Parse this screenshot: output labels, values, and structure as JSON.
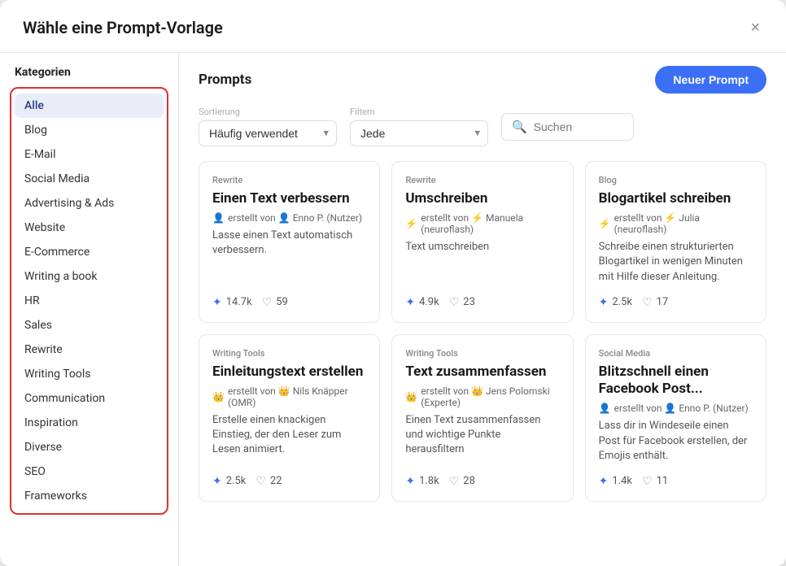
{
  "modal": {
    "title": "Wähle eine Prompt-Vorlage",
    "close_label": "×"
  },
  "sidebar": {
    "title": "Kategorien",
    "categories": [
      {
        "label": "Alle",
        "active": true
      },
      {
        "label": "Blog",
        "active": false
      },
      {
        "label": "E-Mail",
        "active": false
      },
      {
        "label": "Social Media",
        "active": false
      },
      {
        "label": "Advertising & Ads",
        "active": false
      },
      {
        "label": "Website",
        "active": false
      },
      {
        "label": "E-Commerce",
        "active": false
      },
      {
        "label": "Writing a book",
        "active": false
      },
      {
        "label": "HR",
        "active": false
      },
      {
        "label": "Sales",
        "active": false
      },
      {
        "label": "Rewrite",
        "active": false
      },
      {
        "label": "Writing Tools",
        "active": false
      },
      {
        "label": "Communication",
        "active": false
      },
      {
        "label": "Inspiration",
        "active": false
      },
      {
        "label": "Diverse",
        "active": false
      },
      {
        "label": "SEO",
        "active": false
      },
      {
        "label": "Frameworks",
        "active": false
      }
    ]
  },
  "prompts": {
    "title": "Prompts",
    "new_prompt_label": "Neuer Prompt",
    "sort_label": "Sortierung",
    "sort_value": "Häufig verwendet",
    "filter_label": "Filtern",
    "filter_value": "Jede",
    "search_placeholder": "Suchen"
  },
  "cards": [
    {
      "category": "Rewrite",
      "title": "Einen Text verbessern",
      "author": "Enno P. (Nutzer)",
      "author_icon": "user",
      "description": "Lasse einen Text automatisch verbessern.",
      "uses": "14.7k",
      "likes": "59"
    },
    {
      "category": "Rewrite",
      "title": "Umschreiben",
      "author": "Manuela (neuroflash)",
      "author_icon": "bolt",
      "description": "Text umschreiben",
      "uses": "4.9k",
      "likes": "23"
    },
    {
      "category": "Blog",
      "title": "Blogartikel schreiben",
      "author": "Julia (neuroflash)",
      "author_icon": "bolt",
      "description": "Schreibe einen strukturierten Blogartikel in wenigen Minuten mit Hilfe dieser Anleitung.",
      "uses": "2.5k",
      "likes": "17"
    },
    {
      "category": "Writing Tools",
      "title": "Einleitungstext erstellen",
      "author": "Nils Knäpper (OMR)",
      "author_icon": "crown",
      "description": "Erstelle einen knackigen Einstieg, der den Leser zum Lesen animiert.",
      "uses": "2.5k",
      "likes": "22"
    },
    {
      "category": "Writing Tools",
      "title": "Text zusammenfassen",
      "author": "Jens Polomski (Experte)",
      "author_icon": "crown",
      "description": "Einen Text zusammenfassen und wichtige Punkte herausfiltern",
      "uses": "1.8k",
      "likes": "28"
    },
    {
      "category": "Social Media",
      "title": "Blitzschnell einen Facebook Post...",
      "author": "Enno P. (Nutzer)",
      "author_icon": "user",
      "description": "Lass dir in Windeseile einen Post für Facebook erstellen, der Emojis enthält.",
      "uses": "1.4k",
      "likes": "11"
    }
  ]
}
